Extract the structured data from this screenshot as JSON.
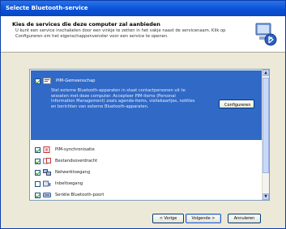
{
  "window": {
    "title": "Selecte Bluetooth-service"
  },
  "header": {
    "title": "Kies de services die deze computer zal aanbieden",
    "description": "U kunt een service inschakelen door een vinkje te zetten in het vakje naast de servicenaam. Klik op Configureren om het eigenschappenvenster voor een service te openen."
  },
  "services": {
    "selected": {
      "label": "PIM-Gemeenschap",
      "checked": true,
      "description": "Stel externe Bluetooth-apparaten in staat contactpersonen uit te wisselen met deze computer. Accepteer PIM-items (Personal Information Management) zoals agenda-items, visitekaartjes, notities en berichten van externe Bluetooth-apparaten.",
      "configure_label": "Configureren"
    },
    "items": [
      {
        "label": "PIM-synchronisatie",
        "checked": true,
        "icon": "sync-icon"
      },
      {
        "label": "Bestandsoverdracht",
        "checked": true,
        "icon": "file-transfer-icon"
      },
      {
        "label": "Netwerktoegang",
        "checked": true,
        "icon": "network-icon"
      },
      {
        "label": "Inbeltoegang",
        "checked": false,
        "icon": "dialup-icon"
      },
      {
        "label": "Seriële Bluetooth-poort",
        "checked": true,
        "icon": "serial-port-icon"
      }
    ]
  },
  "buttons": {
    "back": "< Vorige",
    "next": "Volgende >",
    "cancel": "Annuleren"
  }
}
